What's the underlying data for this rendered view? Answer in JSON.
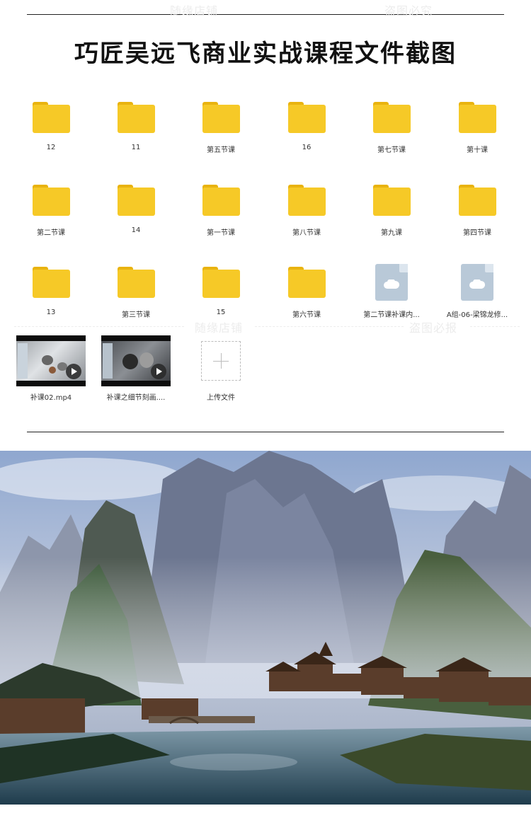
{
  "title": "巧匠吴远飞商业实战课程文件截图",
  "watermarks": [
    "随缘店铺",
    "盗图必究",
    "随缘店铺",
    "盗图必报"
  ],
  "files": [
    {
      "label": "12",
      "kind": "folder"
    },
    {
      "label": "11",
      "kind": "folder"
    },
    {
      "label": "第五节课",
      "kind": "folder"
    },
    {
      "label": "16",
      "kind": "folder"
    },
    {
      "label": "第七节课",
      "kind": "folder"
    },
    {
      "label": "第十课",
      "kind": "folder"
    },
    {
      "label": "第二节课",
      "kind": "folder"
    },
    {
      "label": "14",
      "kind": "folder"
    },
    {
      "label": "第一节课",
      "kind": "folder"
    },
    {
      "label": "第八节课",
      "kind": "folder"
    },
    {
      "label": "第九课",
      "kind": "folder"
    },
    {
      "label": "第四节课",
      "kind": "folder"
    },
    {
      "label": "13",
      "kind": "folder"
    },
    {
      "label": "第三节课",
      "kind": "folder"
    },
    {
      "label": "15",
      "kind": "folder"
    },
    {
      "label": "第六节课",
      "kind": "folder"
    },
    {
      "label": "第二节课补课内...",
      "kind": "cloud-file"
    },
    {
      "label": "A组-06-梁锦龙修...",
      "kind": "cloud-file"
    },
    {
      "label": "补课02.mp4",
      "kind": "video"
    },
    {
      "label": "补课之细节刻画....",
      "kind": "video"
    }
  ],
  "upload_label": "上传文件",
  "colors": {
    "folder": "#f6c927",
    "folder_tab": "#e9b310",
    "cloud_file": "#b9c9d8"
  }
}
